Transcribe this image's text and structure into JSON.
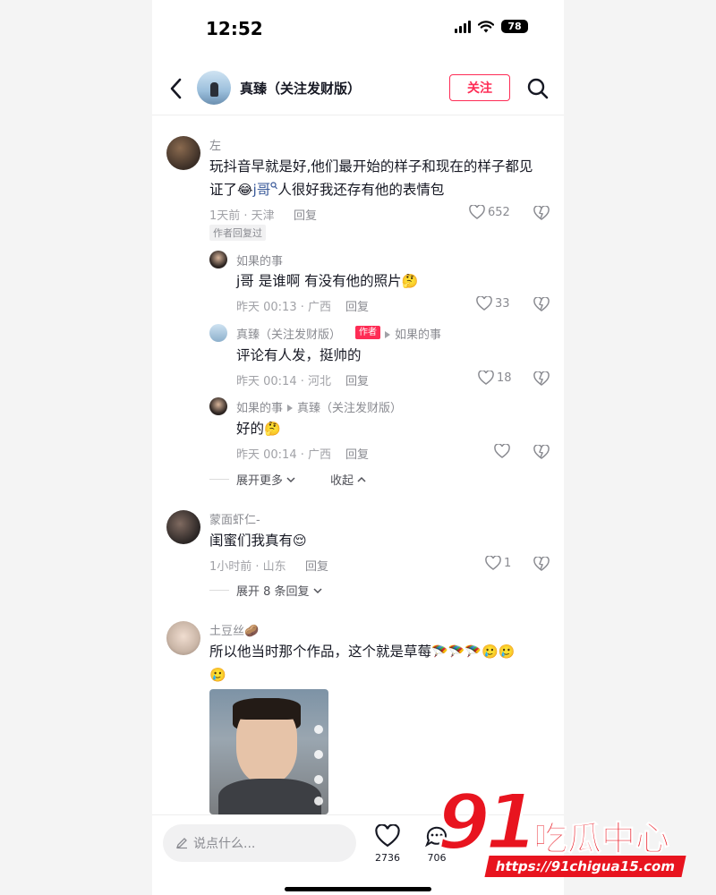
{
  "status_bar": {
    "time": "12:52",
    "battery": "78"
  },
  "header": {
    "name": "真臻（关注发财版）",
    "follow_label": "关注"
  },
  "comments": [
    {
      "user": "左",
      "text_parts": [
        "玩抖音早就是好,他们最开始的样子和现在的样子都见",
        "证了",
        "😂",
        "j哥",
        "人很好我还存有他的表情包"
      ],
      "time_loc": "1天前 · 天津",
      "reply": "回复",
      "likes": "652",
      "badge": "作者回复过",
      "replies": [
        {
          "user": "如果的事",
          "text": "j哥 是谁啊 有没有他的照片",
          "emoji": "🤔",
          "time_loc": "昨天 00:13 · 广西",
          "reply": "回复",
          "likes": "33"
        },
        {
          "user": "真臻（关注发财版）",
          "author_tag": "作者",
          "to_user": "如果的事",
          "text": "评论有人发，挺帅的",
          "time_loc": "昨天 00:14 · 河北",
          "reply": "回复",
          "likes": "18"
        },
        {
          "user": "如果的事",
          "to_user": "真臻（关注发财版）",
          "text": "好的",
          "emoji": "🤔",
          "time_loc": "昨天 00:14 · 广西",
          "reply": "回复",
          "likes": ""
        }
      ],
      "expand_more": "展开更多",
      "collapse": "收起"
    },
    {
      "user": "蒙面虾仁-",
      "text": "闺蜜们我真有",
      "emoji": "😌",
      "time_loc": "1小时前 · 山东",
      "reply": "回复",
      "likes": "1",
      "expand_replies": "展开 8 条回复"
    },
    {
      "user": "土豆丝",
      "user_emoji": "🥔",
      "text": "所以他当时那个作品，这个就是草莓",
      "emoji": "🪂🪂🪂🥲🥲",
      "emoji2": "🥲"
    }
  ],
  "bottom_bar": {
    "input_placeholder": "说点什么...",
    "likes": "2736",
    "comments": "706"
  },
  "watermark": {
    "number": "91",
    "text": "吃瓜中心",
    "url": "https://91chigua15.com"
  }
}
